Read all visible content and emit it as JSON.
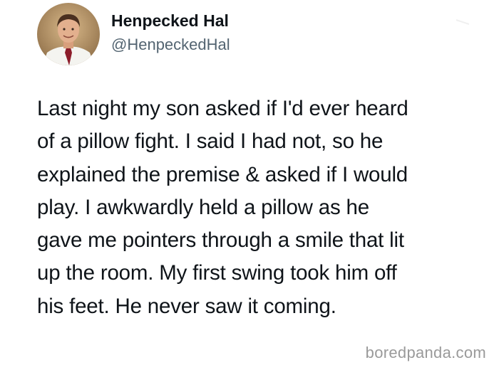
{
  "tweet": {
    "author": {
      "display_name": "Henpecked Hal",
      "handle": "@HenpeckedHal",
      "avatar_icon": "user-avatar-photo"
    },
    "body_lines": [
      "Last night my son asked if I'd ever heard",
      "of a pillow fight. I said I had not, so he",
      "explained the premise & asked if I would",
      "play. I awkwardly held a pillow as he",
      "gave me pointers through a smile that lit",
      "up the room. My first swing took him off",
      "his feet. He never saw it coming."
    ]
  },
  "watermark": {
    "text": "boredpanda.com"
  },
  "colors": {
    "background": "#ffffff",
    "text_primary": "#0f1419",
    "text_secondary": "#536471",
    "watermark": "#9a9a9a"
  }
}
